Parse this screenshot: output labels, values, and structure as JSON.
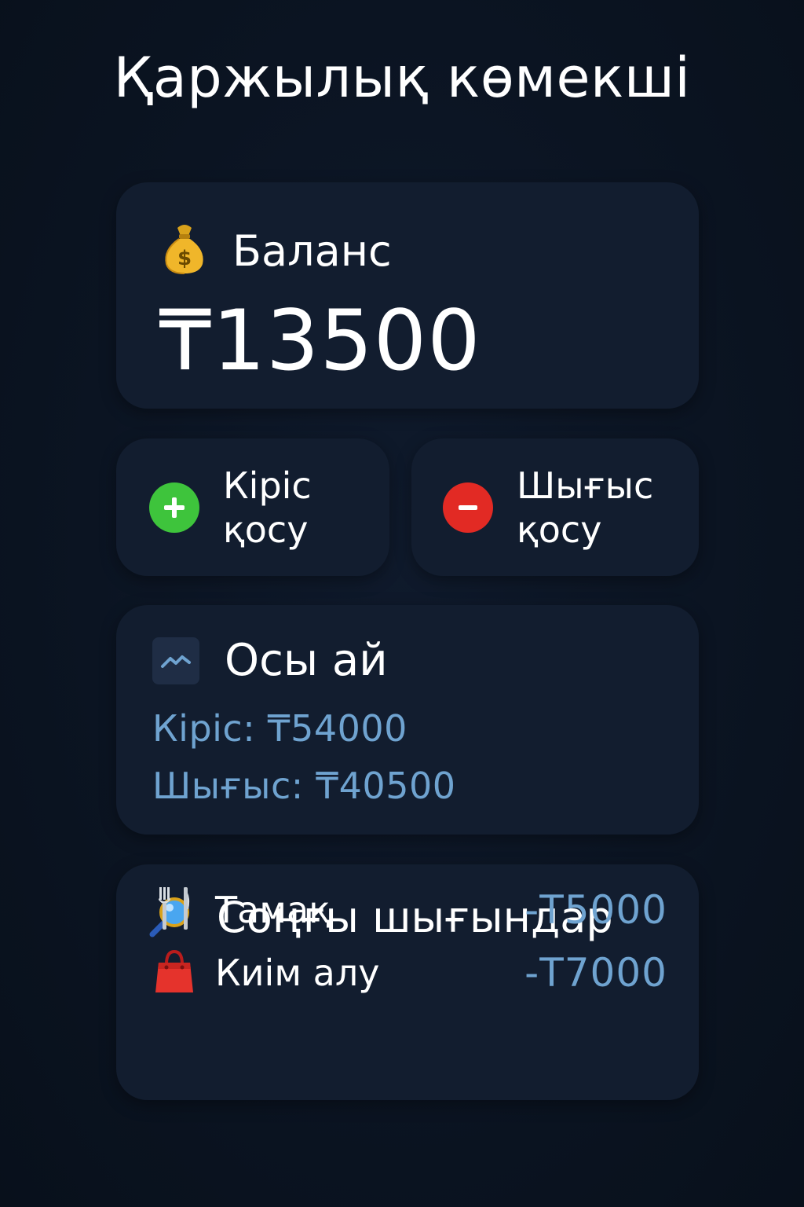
{
  "app": {
    "title": "Қаржылық көмекші"
  },
  "balance": {
    "label": "Баланс",
    "amount": "₸13500",
    "icon": "money-bag-icon"
  },
  "actions": {
    "income": {
      "label": "Кіріс қосу",
      "icon": "plus-circle-icon",
      "color": "#3ec43c"
    },
    "expense": {
      "label": "Шығыс қосу",
      "icon": "minus-circle-icon",
      "color": "#e22a24"
    }
  },
  "month": {
    "title": "Осы ай",
    "icon": "chart-line-icon",
    "income": "Кіріс: ₸54000",
    "expense": "Шығыс: ₸40500"
  },
  "recent": {
    "title": "Соңғы шығындар",
    "icon": "magnifier-icon",
    "items": [
      {
        "name": "Тамақ",
        "amount": "-Т5000",
        "icon": "fork-knife-icon"
      },
      {
        "name": "Киім алу",
        "amount": "-Т7000",
        "icon": "shopping-bag-icon"
      }
    ]
  },
  "colors": {
    "background": "#0b1422",
    "card": "#121d2f",
    "accent_text": "#6fa3d0",
    "positive": "#3ec43c",
    "negative": "#e22a24"
  }
}
